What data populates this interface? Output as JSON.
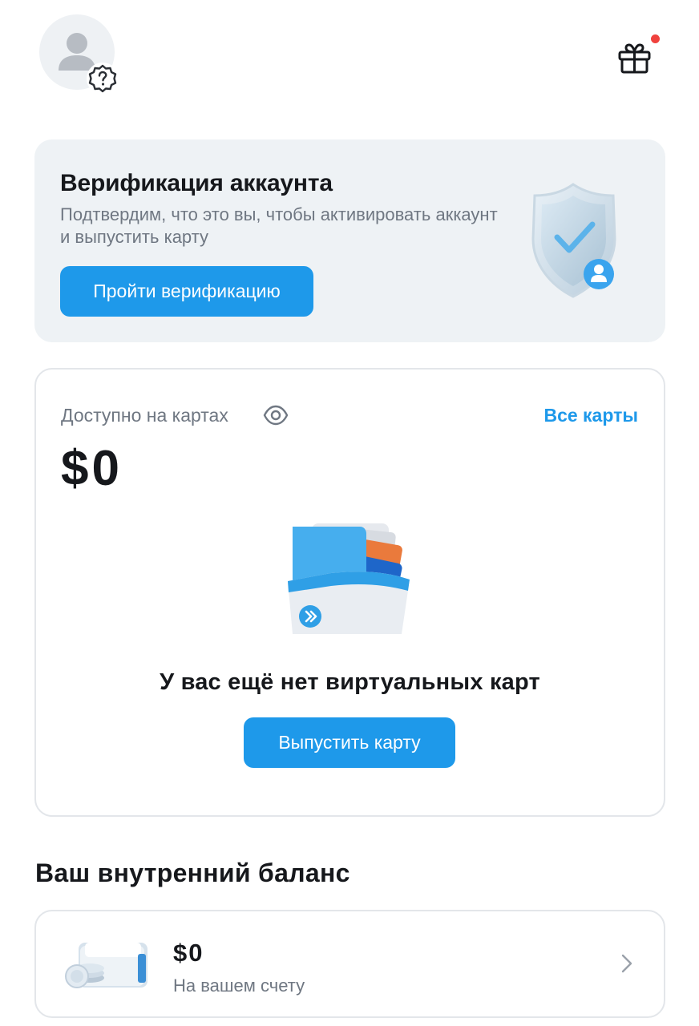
{
  "header": {
    "avatar_icon": "user-icon",
    "avatar_badge_icon": "question-badge-icon",
    "gift_icon": "gift-icon",
    "notification_dot_color": "#f0423e"
  },
  "verification": {
    "title": "Верификация аккаунта",
    "description": "Подтвердим, что это вы, чтобы активировать аккаунт и выпустить карту",
    "button_label": "Пройти верификацию",
    "illustration": "shield-check-icon"
  },
  "cards": {
    "available_label": "Доступно на картах",
    "eye_icon": "eye-icon",
    "all_cards_link": "Все карты",
    "amount": "$0",
    "illustration": "folder-cards-icon",
    "empty_text": "У вас ещё нет виртуальных карт",
    "issue_button_label": "Выпустить карту"
  },
  "internal_balance": {
    "title": "Ваш внутренний баланс",
    "amount": "$0",
    "subtitle": "На вашем счету",
    "wallet_icon": "wallet-icon",
    "chevron_icon": "chevron-right-icon"
  },
  "colors": {
    "accent": "#1e99ea",
    "card_background": "#eef2f5",
    "muted_text": "#6f7782",
    "border": "#e3e6ea"
  }
}
